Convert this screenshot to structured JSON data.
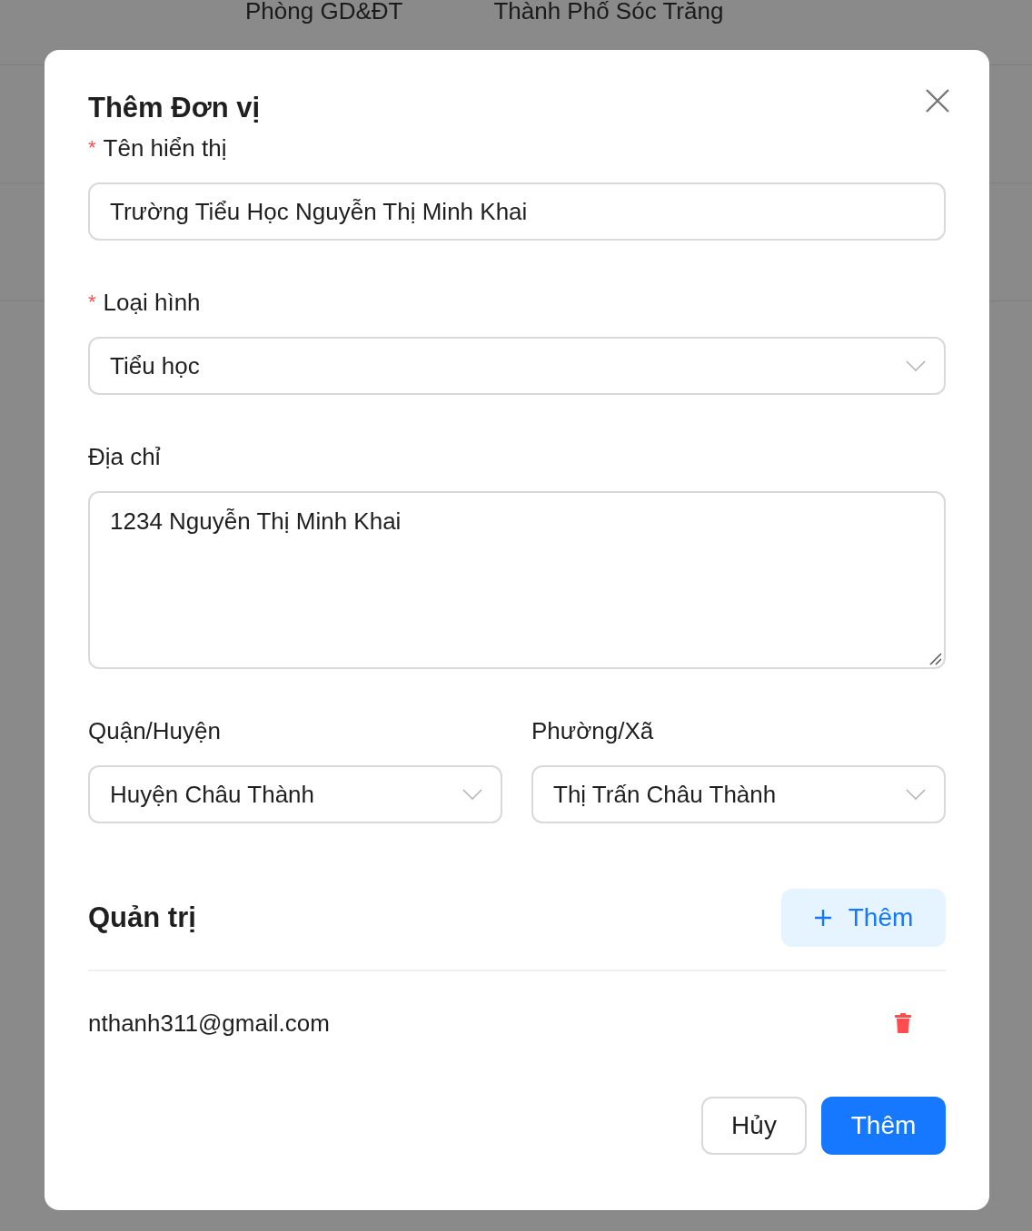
{
  "background": {
    "row": [
      "Phòng GD&ĐT",
      "Thành Phố Sóc Trăng"
    ]
  },
  "dialog": {
    "title": "Thêm Đơn vị",
    "fields": [
      {
        "kind": "input",
        "label": "Tên hiển thị",
        "required_mark": "*",
        "value": "Trường Tiểu Học Nguyễn Thị Minh Khai"
      },
      {
        "kind": "select",
        "label": "Loại hình",
        "required_mark": "*",
        "value": "Tiểu học"
      },
      {
        "kind": "textarea",
        "label": "Địa chỉ",
        "value": "1234 Nguyễn Thị Minh Khai"
      }
    ],
    "pair": [
      {
        "kind": "select",
        "label": "Quận/Huyện",
        "value": "Huyện Châu Thành"
      },
      {
        "kind": "select",
        "label": "Phường/Xã",
        "value": "Thị Trấn Châu Thành"
      }
    ],
    "admins": {
      "title": "Quản trị",
      "add_button": "Thêm",
      "items": [
        "nthanh311@gmail.com"
      ]
    },
    "buttons": {
      "cancel": "Hủy",
      "submit": "Thêm"
    }
  }
}
